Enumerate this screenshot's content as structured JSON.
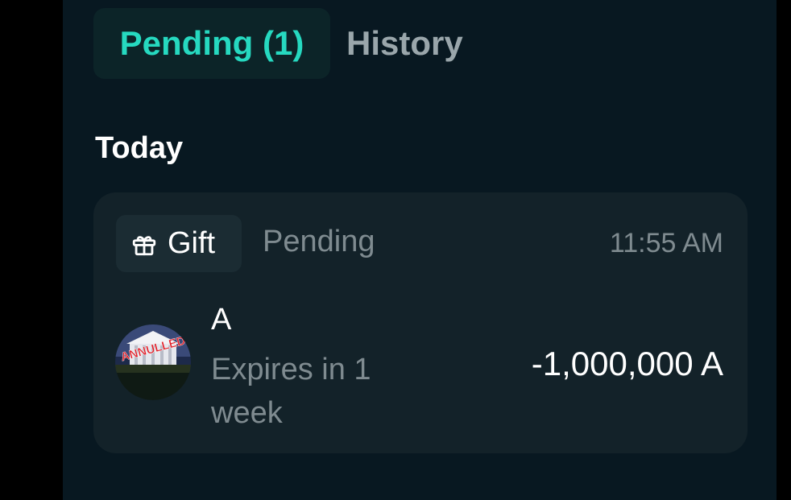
{
  "tabs": {
    "pending_label": "Pending (1)",
    "history_label": "History"
  },
  "section": {
    "heading": "Today"
  },
  "transaction": {
    "type_label": "Gift",
    "type_icon": "gift-icon",
    "status": "Pending",
    "time": "11:55 AM",
    "token_name": "A",
    "avatar_stamp_text": "ANNULLED",
    "expiry": "Expires in 1 week",
    "amount": "-1,000,000 A"
  },
  "colors": {
    "accent": "#26d9c0",
    "background": "#081821",
    "card": "#132229",
    "muted_text": "#7f8b90",
    "stamp_red": "#e0202a"
  }
}
